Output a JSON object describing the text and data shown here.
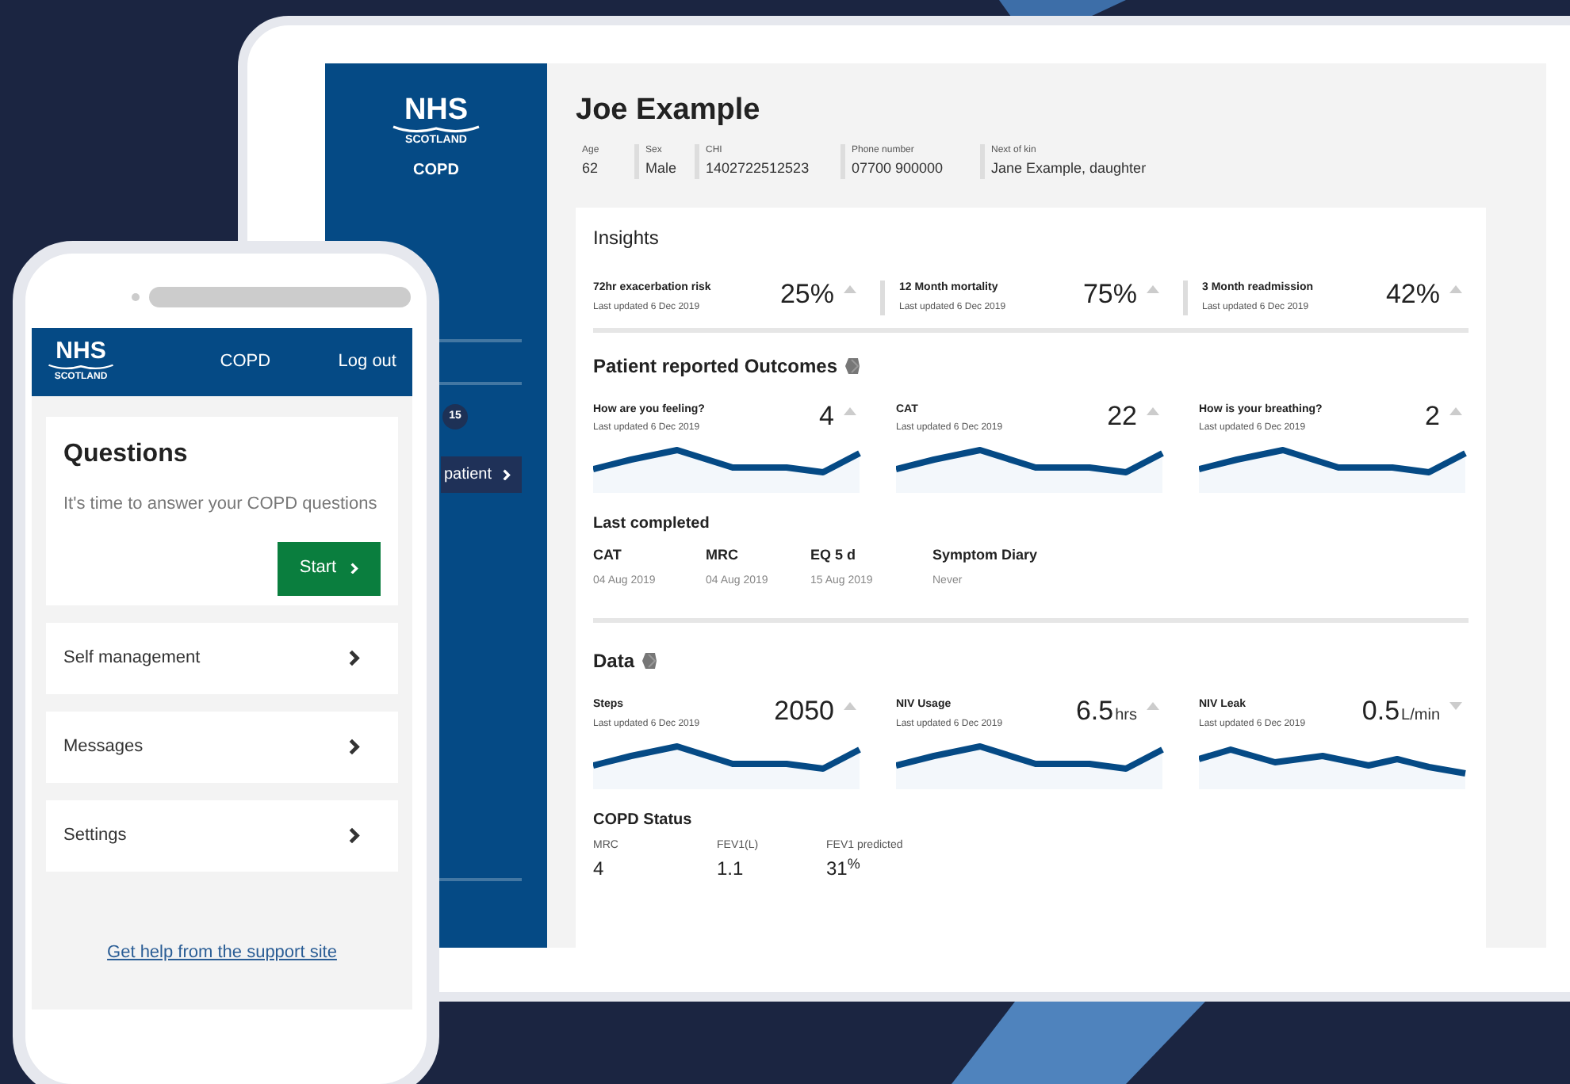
{
  "tablet": {
    "sidebar": {
      "logo": {
        "main": "NHS",
        "sub": "SCOTLAND"
      },
      "app_name": "COPD",
      "badge": "15",
      "button": "patient"
    },
    "patient": {
      "name": "Joe Example",
      "details": [
        {
          "label": "Age",
          "value": "62"
        },
        {
          "label": "Sex",
          "value": "Male"
        },
        {
          "label": "CHI",
          "value": "1402722512523"
        },
        {
          "label": "Phone number",
          "value": "07700 900000"
        },
        {
          "label": "Next of kin",
          "value": "Jane Example, daughter"
        }
      ]
    },
    "insights": {
      "title": "Insights",
      "items": [
        {
          "label": "72hr exacerbation risk",
          "updated": "Last updated 6 Dec 2019",
          "value": "25%",
          "trend_up": true
        },
        {
          "label": "12 Month mortality",
          "updated": "Last updated 6 Dec 2019",
          "value": "75%",
          "trend_up": true
        },
        {
          "label": "3  Month readmission",
          "updated": "Last updated 6 Dec 2019",
          "value": "42%",
          "trend_up": true
        }
      ]
    },
    "outcomes": {
      "title": "Patient reported Outcomes",
      "items": [
        {
          "label": "How are you feeling?",
          "updated": "Last updated 6 Dec 2019",
          "value": "4",
          "trend_up": true
        },
        {
          "label": "CAT",
          "updated": "Last updated 6 Dec 2019",
          "value": "22",
          "trend_up": true
        },
        {
          "label": "How is your breathing?",
          "updated": "Last updated 6 Dec 2019",
          "value": "2",
          "trend_up": true
        }
      ]
    },
    "last_completed": {
      "title": "Last completed",
      "items": [
        {
          "name": "CAT",
          "date": "04 Aug 2019"
        },
        {
          "name": "MRC",
          "date": "04 Aug 2019"
        },
        {
          "name": "EQ 5 d",
          "date": "15 Aug 2019"
        },
        {
          "name": "Symptom Diary",
          "date": "Never"
        }
      ]
    },
    "data_section": {
      "title": "Data",
      "items": [
        {
          "label": "Steps",
          "updated": "Last updated 6 Dec 2019",
          "value": "2050",
          "trend_up": true
        },
        {
          "label": "NIV Usage",
          "updated": "Last updated 6 Dec 2019",
          "value": "6.5",
          "unit": "hrs",
          "trend_up": true
        },
        {
          "label": "NIV Leak",
          "updated": "Last updated 6 Dec 2019",
          "value": "0.5",
          "unit": "L/min",
          "trend_up": false
        }
      ]
    },
    "copd_status": {
      "title": "COPD Status",
      "items": [
        {
          "label": "MRC",
          "value": "4"
        },
        {
          "label": "FEV1(L)",
          "value": "1.1"
        },
        {
          "label": "FEV1 predicted",
          "value": "31$^{%}$"
        }
      ]
    }
  },
  "phone": {
    "header": {
      "logo": {
        "main": "NHS",
        "sub": "SCOTLAND"
      },
      "title": "COPD",
      "logout": "Log out"
    },
    "questions": {
      "title": "Questions",
      "text": "It's time to answer your COPD questions",
      "button": "Start"
    },
    "menu": [
      "Self management",
      "Messages",
      "Settings"
    ],
    "help_link": "Get help from the support site"
  }
}
